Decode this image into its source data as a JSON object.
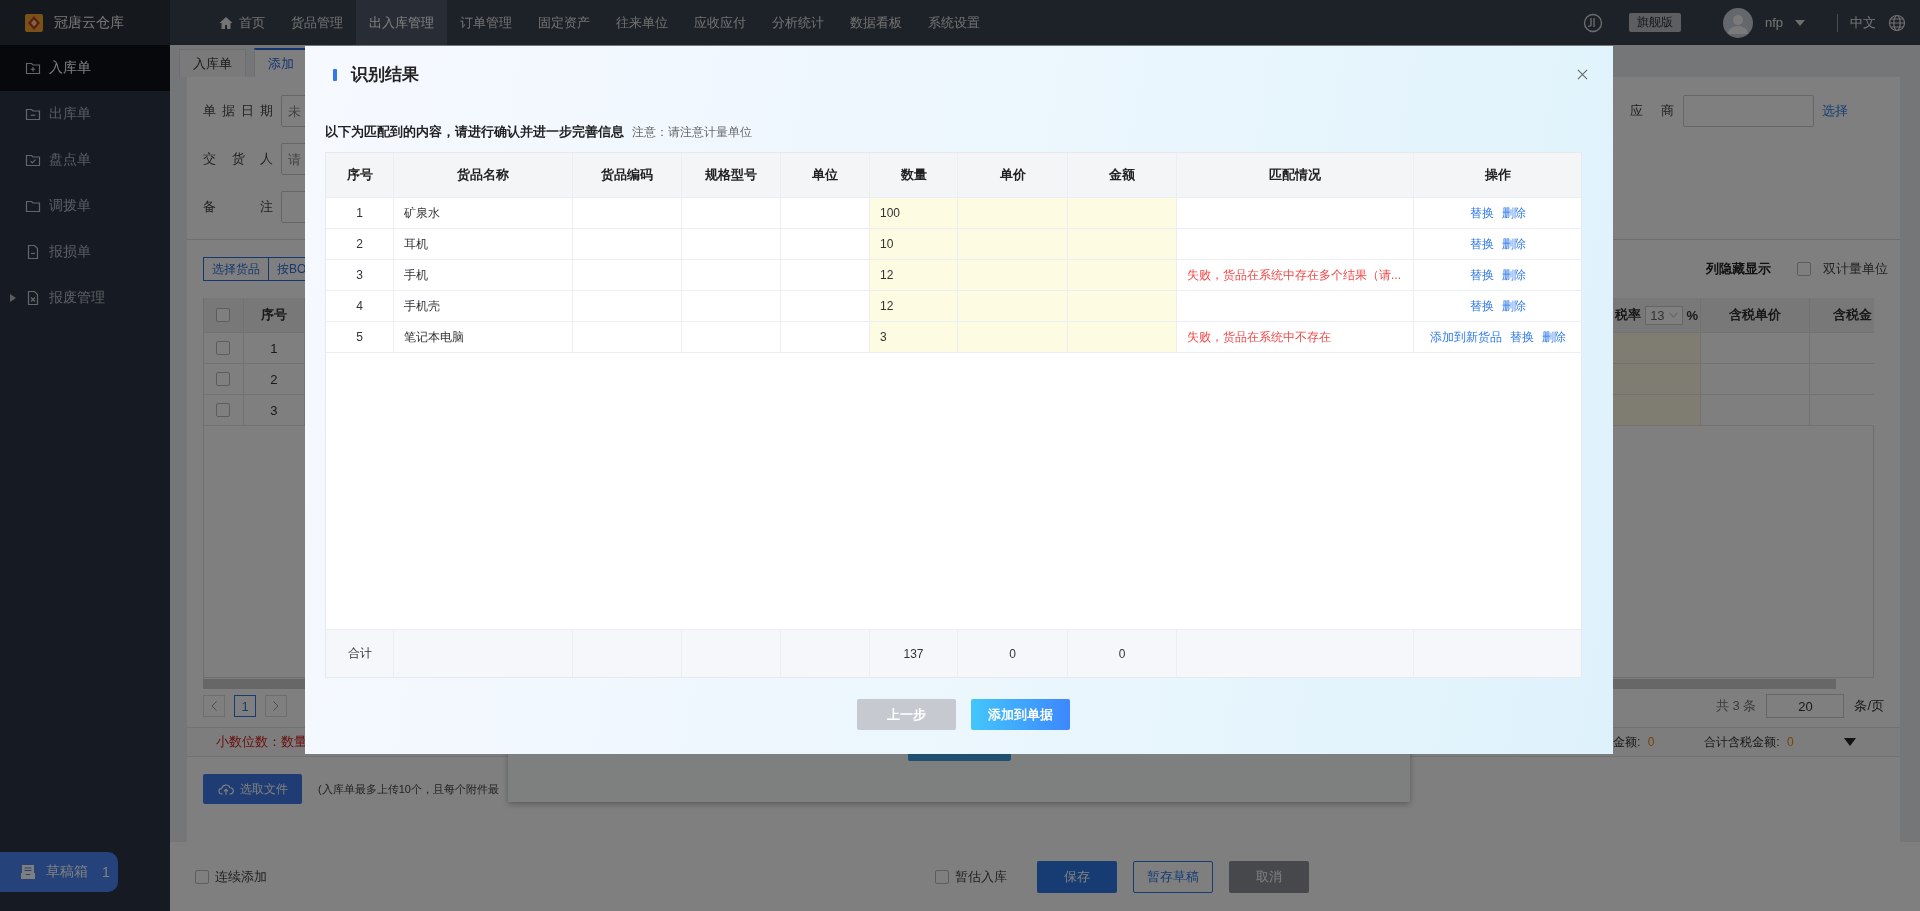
{
  "topbar": {
    "brand": "冠唐云仓库",
    "nav": [
      {
        "label": "首页",
        "kind": "home",
        "selected": false
      },
      {
        "label": "货品管理",
        "kind": "text",
        "selected": false
      },
      {
        "label": "出入库管理",
        "kind": "text",
        "selected": true
      },
      {
        "label": "订单管理",
        "kind": "text",
        "selected": false
      },
      {
        "label": "固定资产",
        "kind": "text",
        "selected": false
      },
      {
        "label": "往来单位",
        "kind": "text",
        "selected": false
      },
      {
        "label": "应收应付",
        "kind": "text",
        "selected": false
      },
      {
        "label": "分析统计",
        "kind": "text",
        "selected": false
      },
      {
        "label": "数据看板",
        "kind": "text",
        "selected": false
      },
      {
        "label": "系统设置",
        "kind": "text",
        "selected": false
      }
    ],
    "edition": "旗舰版",
    "user": "nfp",
    "language": "中文"
  },
  "sidebar": {
    "items": [
      {
        "label": "入库单",
        "kind": "folder-plus",
        "selected": true
      },
      {
        "label": "出库单",
        "kind": "folder-minus",
        "selected": false
      },
      {
        "label": "盘点单",
        "kind": "folder-check",
        "selected": false
      },
      {
        "label": "调拨单",
        "kind": "folder",
        "selected": false
      },
      {
        "label": "报损单",
        "kind": "file",
        "selected": false
      },
      {
        "label": "报废管理",
        "kind": "file-x",
        "selected": false,
        "expanded": false
      }
    ],
    "drafts": {
      "label": "草稿箱",
      "count": "1"
    }
  },
  "page": {
    "tabs": [
      {
        "label": "入库单",
        "selected": false
      },
      {
        "label": "添加",
        "selected": true
      }
    ],
    "form": [
      {
        "label": "单据日期",
        "placeholder": "未"
      },
      {
        "label": "交货人",
        "placeholder": "请"
      },
      {
        "label": "备注"
      }
    ],
    "supplier": {
      "label": "应商",
      "action": "选择"
    },
    "toolbar": {
      "buttons": [
        "选择货品",
        "按BO"
      ],
      "column_toggle": "列隐藏显示",
      "dual_unit": {
        "label": "双计量单位",
        "checked": false
      }
    },
    "table": {
      "index_header": "序号",
      "all_checked": false,
      "rows": [
        {
          "index": "1",
          "checked": false
        },
        {
          "index": "2",
          "checked": false
        },
        {
          "index": "3",
          "checked": false
        }
      ],
      "tax_rate": {
        "label": "税率",
        "value": "13",
        "unit": "%"
      },
      "columns": [
        "含税单价",
        "含税金"
      ]
    },
    "pagination": {
      "page": "1",
      "total": "共 3 条",
      "page_size": "20",
      "unit": "条/页"
    },
    "summary": {
      "decimals": "小数位数：数量",
      "amount": {
        "label": "金额:",
        "value": "0"
      },
      "tax_amount": {
        "label": "合计含税金额:",
        "value": "0"
      }
    },
    "upload": {
      "button": "选取文件",
      "note": "(入库单最多上传10个，且每个附件最"
    },
    "footer": {
      "continuous": {
        "label": "连续添加",
        "checked": false
      },
      "provisional": {
        "label": "暂估入库",
        "checked": false
      },
      "buttons": [
        {
          "label": "保存",
          "kind": "primary"
        },
        {
          "label": "暂存草稿",
          "kind": "outline"
        },
        {
          "label": "取消",
          "kind": "disabled"
        }
      ]
    }
  },
  "dialog": {
    "title": "识别结果",
    "subtitle": "以下为匹配到的内容，请进行确认并进一步完善信息",
    "note": "注意：请注意计量单位",
    "columns": [
      "序号",
      "货品名称",
      "货品编码",
      "规格型号",
      "单位",
      "数量",
      "单价",
      "金额",
      "匹配情况",
      "操作"
    ],
    "rows": [
      {
        "index": "1",
        "name": "矿泉水",
        "quantity": "100",
        "actions": [
          "替换",
          "删除"
        ]
      },
      {
        "index": "2",
        "name": "耳机",
        "quantity": "10",
        "actions": [
          "替换",
          "删除"
        ]
      },
      {
        "index": "3",
        "name": "手机",
        "quantity": "12",
        "match": "失败，货品在系统中存在多个结果（请...",
        "actions": [
          "替换",
          "删除"
        ]
      },
      {
        "index": "4",
        "name": "手机壳",
        "quantity": "12",
        "actions": [
          "替换",
          "删除"
        ]
      },
      {
        "index": "5",
        "name": "笔记本电脑",
        "quantity": "3",
        "match": "失败，货品在系统中不存在",
        "actions": [
          "添加到新货品",
          "替换",
          "删除"
        ]
      }
    ],
    "totals": {
      "label": "合计",
      "quantity": "137",
      "unit_price": "0",
      "amount": "0"
    },
    "buttons": [
      {
        "label": "上一步",
        "kind": "secondary"
      },
      {
        "label": "添加到单据",
        "kind": "primary"
      }
    ]
  }
}
